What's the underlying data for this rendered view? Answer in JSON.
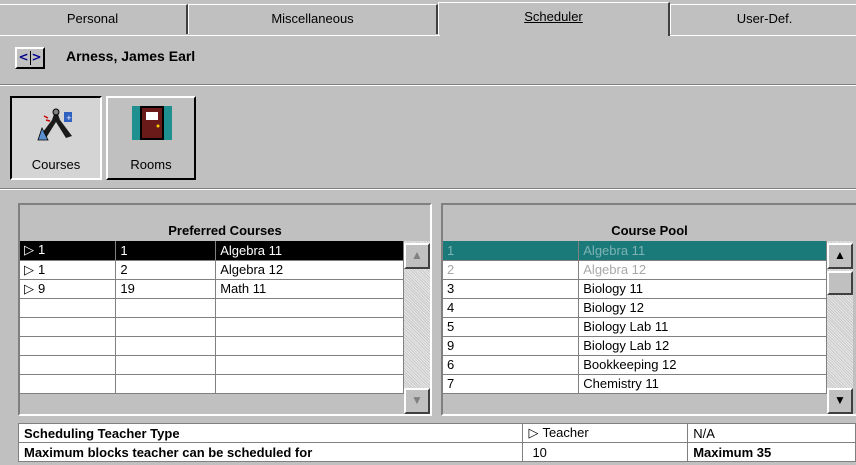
{
  "tabs": [
    {
      "label": "Personal"
    },
    {
      "label": "Miscellaneous"
    },
    {
      "label": "Scheduler"
    },
    {
      "label": "User-Def."
    }
  ],
  "header": {
    "nav_prev_glyph": "<",
    "nav_next_glyph": ">",
    "student_name": "Arness, James Earl"
  },
  "toolbar": {
    "courses_label": "Courses",
    "rooms_label": "Rooms"
  },
  "preferred_courses": {
    "title": "Preferred Courses",
    "rows": [
      {
        "priority": "1",
        "code": "1",
        "name": "Algebra 11",
        "marker": "▷"
      },
      {
        "priority": "1",
        "code": "2",
        "name": "Algebra 12",
        "marker": "▷"
      },
      {
        "priority": "9",
        "code": "19",
        "name": "Math 11",
        "marker": "▷"
      },
      {
        "priority": "",
        "code": "",
        "name": "",
        "marker": ""
      },
      {
        "priority": "",
        "code": "",
        "name": "",
        "marker": ""
      },
      {
        "priority": "",
        "code": "",
        "name": "",
        "marker": ""
      },
      {
        "priority": "",
        "code": "",
        "name": "",
        "marker": ""
      },
      {
        "priority": "",
        "code": "",
        "name": "",
        "marker": ""
      }
    ]
  },
  "course_pool": {
    "title": "Course Pool",
    "rows": [
      {
        "code": "1",
        "name": "Algebra 11"
      },
      {
        "code": "2",
        "name": "Algebra 12"
      },
      {
        "code": "3",
        "name": "Biology 11"
      },
      {
        "code": "4",
        "name": "Biology 12"
      },
      {
        "code": "5",
        "name": "Biology Lab 11"
      },
      {
        "code": "9",
        "name": "Biology Lab 12"
      },
      {
        "code": "6",
        "name": "Bookkeeping 12"
      },
      {
        "code": "7",
        "name": "Chemistry 11"
      }
    ]
  },
  "settings": {
    "rows": [
      {
        "label": "Scheduling Teacher Type",
        "value": "Teacher",
        "marker": "▷",
        "extra": "N/A"
      },
      {
        "label": "Maximum blocks teacher can be scheduled for",
        "value": "10",
        "marker": "",
        "extra": "Maximum 35"
      }
    ]
  },
  "colors": {
    "background": "#c0c0c0",
    "selection": "#000000",
    "pool_selection": "#1a7a7a"
  }
}
